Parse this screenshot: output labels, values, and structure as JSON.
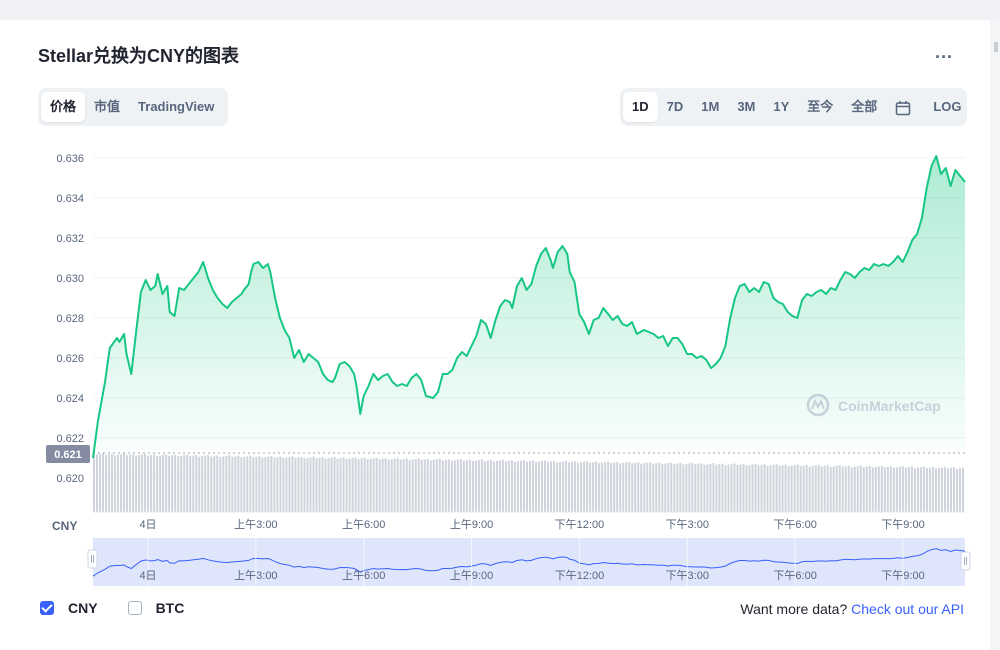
{
  "header": {
    "title": "Stellar兑换为CNY的图表",
    "more": "..."
  },
  "view_tabs": [
    {
      "label": "价格",
      "active": true
    },
    {
      "label": "市值",
      "active": false
    },
    {
      "label": "TradingView",
      "active": false
    }
  ],
  "range_tabs": [
    {
      "label": "1D",
      "active": true
    },
    {
      "label": "7D",
      "active": false
    },
    {
      "label": "1M",
      "active": false
    },
    {
      "label": "3M",
      "active": false
    },
    {
      "label": "1Y",
      "active": false
    },
    {
      "label": "至今",
      "active": false
    },
    {
      "label": "全部",
      "active": false
    }
  ],
  "log_label": "LOG",
  "watermark": "CoinMarketCap",
  "legend": {
    "cny_label": "CNY",
    "btc_label": "BTC",
    "cny_checked": true,
    "btc_checked": false
  },
  "more_data": {
    "text": "Want more data?",
    "link": "Check out our API"
  },
  "colors": {
    "line": "#16c784",
    "accent": "#3861fb",
    "volume": "#cfd3db",
    "navigator_fill": "#dfe6fb"
  },
  "chart_data": {
    "type": "area",
    "title": "Stellar兑换为CNY的图表",
    "currency_label": "CNY",
    "ylim": [
      0.619,
      0.6368
    ],
    "y_ticks": [
      0.62,
      0.622,
      0.624,
      0.626,
      0.628,
      0.63,
      0.632,
      0.634,
      0.636
    ],
    "y_tick_labels": [
      "0.620",
      "0.622",
      "0.624",
      "0.626",
      "0.628",
      "0.630",
      "0.632",
      "0.634",
      "0.636"
    ],
    "x_range": [
      0,
      23.5
    ],
    "x_ticks": [
      {
        "x": 1.25,
        "label": "4日"
      },
      {
        "x": 4.25,
        "label": "上午3:00"
      },
      {
        "x": 7.25,
        "label": "上午6:00"
      },
      {
        "x": 10.25,
        "label": "上午9:00"
      },
      {
        "x": 13.25,
        "label": "下午12:00"
      },
      {
        "x": 16.25,
        "label": "下午3:00"
      },
      {
        "x": 19.25,
        "label": "下午6:00"
      },
      {
        "x": 22.25,
        "label": "下午9:00"
      }
    ],
    "current_price_label": "0.621",
    "grid": true,
    "series": [
      {
        "values": [
          [
            0.0,
            0.621
          ],
          [
            0.1,
            0.6228
          ],
          [
            0.25,
            0.6248
          ],
          [
            0.35,
            0.6265
          ],
          [
            0.5,
            0.627
          ],
          [
            0.55,
            0.6268
          ],
          [
            0.65,
            0.6272
          ],
          [
            0.7,
            0.6262
          ],
          [
            0.8,
            0.6252
          ],
          [
            0.9,
            0.6273
          ],
          [
            1.0,
            0.6293
          ],
          [
            1.1,
            0.6299
          ],
          [
            1.2,
            0.6294
          ],
          [
            1.3,
            0.6296
          ],
          [
            1.35,
            0.6302
          ],
          [
            1.45,
            0.6292
          ],
          [
            1.55,
            0.6296
          ],
          [
            1.6,
            0.6283
          ],
          [
            1.7,
            0.6281
          ],
          [
            1.8,
            0.6295
          ],
          [
            1.9,
            0.6294
          ],
          [
            2.0,
            0.6297
          ],
          [
            2.1,
            0.63
          ],
          [
            2.2,
            0.6303
          ],
          [
            2.3,
            0.6308
          ],
          [
            2.4,
            0.63
          ],
          [
            2.5,
            0.6294
          ],
          [
            2.6,
            0.629
          ],
          [
            2.7,
            0.6287
          ],
          [
            2.8,
            0.6285
          ],
          [
            2.9,
            0.6288
          ],
          [
            3.0,
            0.629
          ],
          [
            3.1,
            0.6292
          ],
          [
            3.15,
            0.6294
          ],
          [
            3.25,
            0.6297
          ],
          [
            3.3,
            0.6303
          ],
          [
            3.35,
            0.6307
          ],
          [
            3.45,
            0.6308
          ],
          [
            3.55,
            0.6305
          ],
          [
            3.65,
            0.6307
          ],
          [
            3.7,
            0.6303
          ],
          [
            3.8,
            0.629
          ],
          [
            3.9,
            0.628
          ],
          [
            4.0,
            0.6274
          ],
          [
            4.1,
            0.627
          ],
          [
            4.2,
            0.626
          ],
          [
            4.3,
            0.6264
          ],
          [
            4.4,
            0.6258
          ],
          [
            4.5,
            0.6262
          ],
          [
            4.6,
            0.626
          ],
          [
            4.7,
            0.6258
          ],
          [
            4.8,
            0.6252
          ],
          [
            4.9,
            0.6249
          ],
          [
            5.0,
            0.6248
          ],
          [
            5.05,
            0.625
          ],
          [
            5.15,
            0.6257
          ],
          [
            5.25,
            0.6258
          ],
          [
            5.35,
            0.6256
          ],
          [
            5.45,
            0.6252
          ],
          [
            5.5,
            0.6246
          ],
          [
            5.58,
            0.6232
          ],
          [
            5.65,
            0.6241
          ],
          [
            5.75,
            0.6246
          ],
          [
            5.85,
            0.6252
          ],
          [
            5.95,
            0.6249
          ],
          [
            6.05,
            0.6251
          ],
          [
            6.15,
            0.6252
          ],
          [
            6.25,
            0.6248
          ],
          [
            6.35,
            0.6246
          ],
          [
            6.45,
            0.6247
          ],
          [
            6.55,
            0.6246
          ],
          [
            6.65,
            0.625
          ],
          [
            6.75,
            0.6252
          ],
          [
            6.85,
            0.6249
          ],
          [
            6.9,
            0.6245
          ],
          [
            6.95,
            0.6241
          ],
          [
            7.1,
            0.624
          ],
          [
            7.2,
            0.6243
          ],
          [
            7.3,
            0.6252
          ],
          [
            7.4,
            0.6252
          ],
          [
            7.5,
            0.6254
          ],
          [
            7.6,
            0.626
          ],
          [
            7.7,
            0.6263
          ],
          [
            7.8,
            0.6261
          ],
          [
            7.9,
            0.6266
          ],
          [
            8.0,
            0.6271
          ],
          [
            8.1,
            0.6279
          ],
          [
            8.2,
            0.6277
          ],
          [
            8.3,
            0.627
          ],
          [
            8.4,
            0.6279
          ],
          [
            8.5,
            0.6286
          ],
          [
            8.6,
            0.6289
          ],
          [
            8.7,
            0.6288
          ],
          [
            8.75,
            0.6285
          ],
          [
            8.85,
            0.6296
          ],
          [
            8.95,
            0.63
          ],
          [
            9.05,
            0.6294
          ],
          [
            9.15,
            0.6297
          ],
          [
            9.25,
            0.6306
          ],
          [
            9.35,
            0.6312
          ],
          [
            9.45,
            0.6315
          ],
          [
            9.55,
            0.6309
          ],
          [
            9.6,
            0.6305
          ],
          [
            9.7,
            0.6313
          ],
          [
            9.8,
            0.6316
          ],
          [
            9.9,
            0.6312
          ],
          [
            9.95,
            0.6303
          ],
          [
            10.05,
            0.6298
          ],
          [
            10.15,
            0.6282
          ],
          [
            10.25,
            0.6278
          ],
          [
            10.35,
            0.6272
          ],
          [
            10.45,
            0.6279
          ],
          [
            10.55,
            0.628
          ],
          [
            10.65,
            0.6285
          ],
          [
            10.75,
            0.6282
          ],
          [
            10.85,
            0.6279
          ],
          [
            10.95,
            0.6281
          ],
          [
            11.05,
            0.6277
          ],
          [
            11.15,
            0.6276
          ],
          [
            11.25,
            0.6278
          ],
          [
            11.35,
            0.6272
          ],
          [
            11.5,
            0.6274
          ],
          [
            11.6,
            0.6273
          ],
          [
            11.7,
            0.6272
          ],
          [
            11.8,
            0.627
          ],
          [
            11.9,
            0.6271
          ],
          [
            12.0,
            0.6266
          ],
          [
            12.1,
            0.627
          ],
          [
            12.2,
            0.627
          ],
          [
            12.3,
            0.6267
          ],
          [
            12.4,
            0.6262
          ],
          [
            12.5,
            0.6262
          ],
          [
            12.6,
            0.626
          ],
          [
            12.7,
            0.6261
          ],
          [
            12.8,
            0.6259
          ],
          [
            12.9,
            0.6255
          ],
          [
            13.0,
            0.6257
          ],
          [
            13.1,
            0.626
          ],
          [
            13.2,
            0.6266
          ],
          [
            13.3,
            0.628
          ],
          [
            13.4,
            0.629
          ],
          [
            13.5,
            0.6296
          ],
          [
            13.6,
            0.6297
          ],
          [
            13.7,
            0.6293
          ],
          [
            13.8,
            0.6295
          ],
          [
            13.9,
            0.6293
          ],
          [
            14.0,
            0.6298
          ],
          [
            14.1,
            0.6297
          ],
          [
            14.2,
            0.629
          ],
          [
            14.3,
            0.6288
          ],
          [
            14.4,
            0.6287
          ],
          [
            14.5,
            0.6283
          ],
          [
            14.6,
            0.6281
          ],
          [
            14.7,
            0.628
          ],
          [
            14.8,
            0.6289
          ],
          [
            14.9,
            0.6292
          ],
          [
            15.0,
            0.6291
          ],
          [
            15.1,
            0.6293
          ],
          [
            15.2,
            0.6294
          ],
          [
            15.3,
            0.6292
          ],
          [
            15.4,
            0.6295
          ],
          [
            15.5,
            0.6294
          ],
          [
            15.6,
            0.6299
          ],
          [
            15.7,
            0.6303
          ],
          [
            15.8,
            0.6302
          ],
          [
            15.9,
            0.63
          ],
          [
            16.0,
            0.6303
          ],
          [
            16.1,
            0.6305
          ],
          [
            16.2,
            0.6304
          ],
          [
            16.3,
            0.6307
          ],
          [
            16.4,
            0.6306
          ],
          [
            16.5,
            0.6307
          ],
          [
            16.6,
            0.6306
          ],
          [
            16.7,
            0.6308
          ],
          [
            16.8,
            0.6311
          ],
          [
            16.9,
            0.6308
          ],
          [
            17.0,
            0.6313
          ],
          [
            17.1,
            0.6319
          ],
          [
            17.2,
            0.6322
          ],
          [
            17.3,
            0.633
          ],
          [
            17.4,
            0.6345
          ],
          [
            17.5,
            0.6356
          ],
          [
            17.6,
            0.6361
          ],
          [
            17.7,
            0.6352
          ],
          [
            17.8,
            0.6355
          ],
          [
            17.9,
            0.6346
          ],
          [
            18.0,
            0.6354
          ],
          [
            18.1,
            0.6351
          ],
          [
            18.2,
            0.6348
          ]
        ]
      }
    ]
  }
}
